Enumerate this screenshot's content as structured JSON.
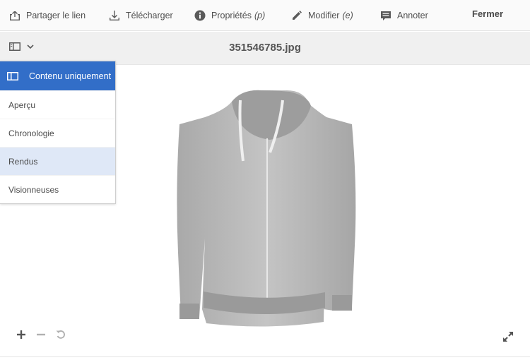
{
  "toolbar": {
    "share_label": "Partager le lien",
    "download_label": "Télécharger",
    "properties_label": "Propriétés",
    "properties_shortcut": "(p)",
    "edit_label": "Modifier",
    "edit_shortcut": "(e)",
    "annotate_label": "Annoter",
    "close_label": "Fermer"
  },
  "header": {
    "file_name": "351546785.jpg"
  },
  "rail_menu": {
    "header_label": "Contenu uniquement",
    "items": [
      {
        "label": "Aperçu",
        "selected": false
      },
      {
        "label": "Chronologie",
        "selected": false
      },
      {
        "label": "Rendus",
        "selected": true
      },
      {
        "label": "Visionneuses",
        "selected": false
      }
    ]
  },
  "icons": {
    "share": "share-icon",
    "download": "download-icon",
    "properties": "info-icon",
    "edit": "pencil-icon",
    "annotate": "comment-icon",
    "rail_toggle": "rail-panel-icon",
    "zoom_in": "plus-icon",
    "zoom_out": "minus-icon",
    "reset": "reset-icon",
    "fullscreen": "fullscreen-icon"
  },
  "colors": {
    "accent": "#326ec8",
    "selected_row": "#dfe8f7"
  }
}
